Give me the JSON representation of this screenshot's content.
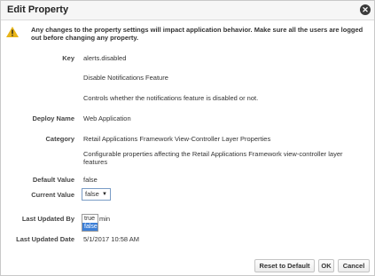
{
  "dialog": {
    "title": "Edit Property",
    "warning": "Any changes to the property settings will impact application behavior. Make sure all the users are logged out before changing any property."
  },
  "fields": {
    "key_label": "Key",
    "key_value": "alerts.disabled",
    "key_name": "Disable Notifications Feature",
    "key_description": "Controls whether the notifications feature is disabled or not.",
    "deploy_label": "Deploy Name",
    "deploy_value": "Web Application",
    "category_label": "Category",
    "category_value": "Retail Applications Framework View-Controller Layer Properties",
    "category_description": "Configurable properties affecting the Retail Applications Framework view-controller layer features",
    "default_label": "Default Value",
    "default_value": "false",
    "current_label": "Current Value",
    "current_value": "false",
    "current_options": [
      "true",
      "false"
    ],
    "updated_by_label": "Last Updated By",
    "updated_by_value": "min",
    "updated_date_label": "Last Updated Date",
    "updated_date_value": "5/1/2017 10:58 AM"
  },
  "buttons": {
    "reset": "Reset to Default",
    "ok": "OK",
    "cancel": "Cancel"
  },
  "icons": {
    "close": "close-icon",
    "warning": "warning-icon"
  },
  "colors": {
    "accent": "#3c7fd7",
    "warning": "#e8b418"
  }
}
